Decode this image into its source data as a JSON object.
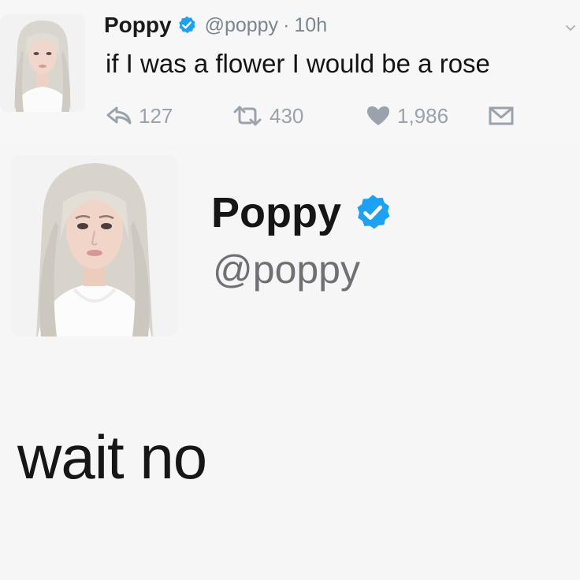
{
  "tweet": {
    "author_name": "Poppy",
    "handle": "@poppy",
    "separator": "·",
    "time": "10h",
    "text": "if I was a flower I would be a rose",
    "avatar_icon": "profile-photo",
    "verified_icon": "verified-badge-icon",
    "verified_color": "#1da1f2",
    "actions": {
      "replies": "127",
      "retweets": "430",
      "likes": "1,986"
    }
  },
  "profile": {
    "name": "Poppy",
    "handle": "@poppy",
    "avatar_icon": "profile-photo",
    "verified_icon": "verified-badge-icon"
  },
  "caption": "wait no",
  "colors": {
    "background": "#f6f6f7",
    "text": "#1a1a1a",
    "muted": "#7a8590",
    "verified": "#1da1f2"
  }
}
